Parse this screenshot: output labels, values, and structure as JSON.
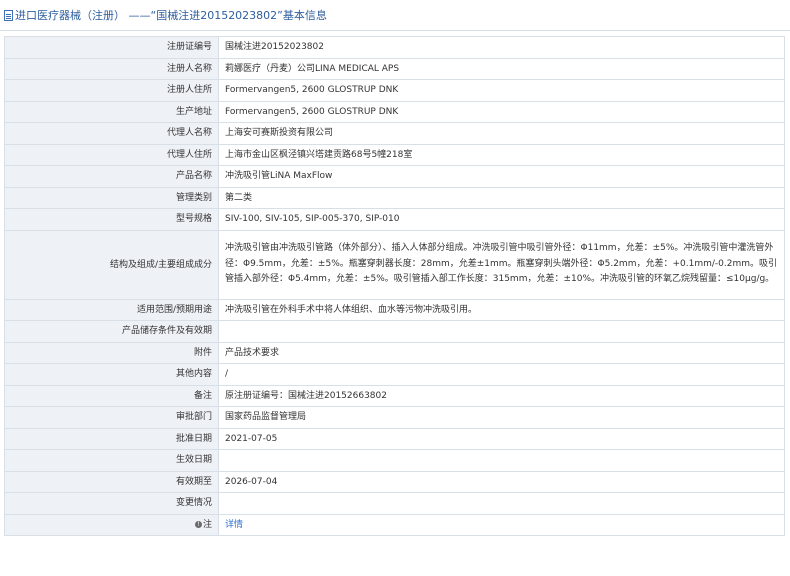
{
  "page_title": "进口医疗器械（注册） ——“国械注进20152023802”基本信息",
  "rows": [
    {
      "label": "注册证编号",
      "value": "国械注进20152023802"
    },
    {
      "label": "注册人名称",
      "value": "莉娜医疗（丹麦）公司LINA MEDICAL APS"
    },
    {
      "label": "注册人住所",
      "value": "Formervangen5, 2600 GLOSTRUP DNK"
    },
    {
      "label": "生产地址",
      "value": "Formervangen5, 2600 GLOSTRUP DNK"
    },
    {
      "label": "代理人名称",
      "value": "上海安可赛斯投资有限公司"
    },
    {
      "label": "代理人住所",
      "value": "上海市金山区枫泾镇兴塔建贡路68号5幢218室"
    },
    {
      "label": "产品名称",
      "value": "冲洗吸引管LiNA MaxFlow"
    },
    {
      "label": "管理类别",
      "value": "第二类"
    },
    {
      "label": "型号规格",
      "value": "SIV-100, SIV-105, SIP-005-370, SIP-010"
    },
    {
      "label": "结构及组成/主要组成成分",
      "value": "冲洗吸引管由冲洗吸引管路（体外部分）、插入人体部分组成。冲洗吸引管中吸引管外径：Φ11mm，允差：±5%。冲洗吸引管中灌洗管外径：Φ9.5mm，允差：±5%。瓶塞穿刺器长度：28mm，允差±1mm。瓶塞穿刺头端外径：Φ5.2mm，允差：+0.1mm/-0.2mm。吸引管插入部外径：Φ5.4mm，允差：±5%。吸引管插入部工作长度：315mm，允差：±10%。冲洗吸引管的环氧乙烷残留量：≤10μg/g。"
    },
    {
      "label": "适用范围/预期用途",
      "value": "冲洗吸引管在外科手术中将人体组织、血水等污物冲洗吸引用。"
    },
    {
      "label": "产品储存条件及有效期",
      "value": ""
    },
    {
      "label": "附件",
      "value": "产品技术要求"
    },
    {
      "label": "其他内容",
      "value": "/"
    },
    {
      "label": "备注",
      "value": "原注册证编号：国械注进20152663802"
    },
    {
      "label": "审批部门",
      "value": "国家药品监督管理局"
    },
    {
      "label": "批准日期",
      "value": "2021-07-05"
    },
    {
      "label": "生效日期",
      "value": ""
    },
    {
      "label": "有效期至",
      "value": "2026-07-04"
    },
    {
      "label": "变更情况",
      "value": ""
    },
    {
      "label": "注",
      "value": "详情"
    }
  ]
}
